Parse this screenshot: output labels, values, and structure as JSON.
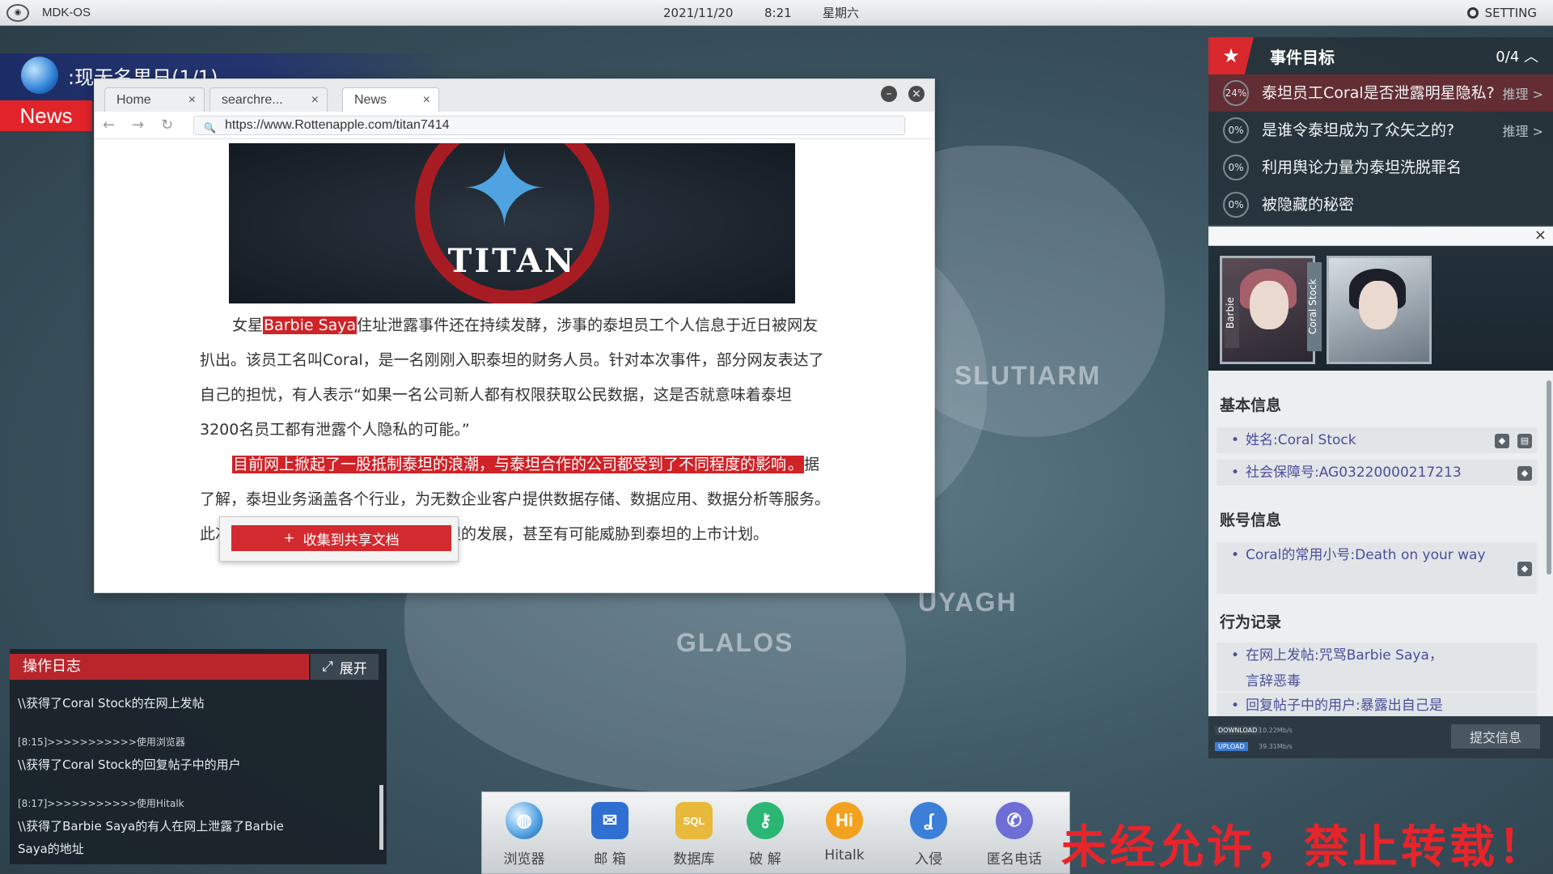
{
  "topbar": {
    "os_name": "MDK-OS",
    "date": "2021/11/20",
    "time": "8:21",
    "weekday": "星期六",
    "setting_label": "SETTING"
  },
  "news_banner": {
    "headline": ":现无名男日(1/1)",
    "label": "News"
  },
  "map_labels": [
    "SLUTIARM",
    "UYAGH",
    "GLALOS"
  ],
  "browser": {
    "tabs": [
      {
        "label": "Home",
        "close": "×"
      },
      {
        "label": "searchre...",
        "close": "×"
      },
      {
        "label": "News",
        "close": "×"
      }
    ],
    "minimize_glyph": "–",
    "close_glyph": "×",
    "nav": {
      "back": "←",
      "forward": "→",
      "reload": "↻"
    },
    "url": "https://www.Rottenapple.com/titan7414",
    "hero_brand": "TITAN",
    "article": {
      "p1_pre": "女星",
      "p1_highlight": "Barbie Saya",
      "p1_post": "住址泄露事件还在持续发酵，涉事的泰坦员工个人信息于近日被网友扒出。该员工名叫Coral，是一名刚刚入职泰坦的财务人员。针对本次事件，部分网友表达了自己的担忧，有人表示“如果一名公司新人都有权限获取公民数据，这是否就意味着泰坦3200名员工都有泄露个人隐私的可能。”",
      "p2_highlight": "目前网上掀起了一股抵制泰坦的浪潮，与泰坦合作的公司都受到了不同程度的影响",
      "p2_highlight_end": "。",
      "p2_post": "据了解，泰坦业务涵盖各个行业，为无数企业客户提供数据存储、数据应用、数据分析等服务。此次抵制风波很可能将极大地影响泰坦的发展，甚至有可能威胁到泰坦的上市计划。"
    },
    "collect_button": "收集到共享文档"
  },
  "events": {
    "title": "事件目标",
    "count": "0/4",
    "items": [
      {
        "percent": "24%",
        "text": "泰坦员工Coral是否泄露明星隐私?",
        "tag": "推理 >"
      },
      {
        "percent": "0%",
        "text": "是谁令泰坦成为了众矢之的?",
        "tag": "推理 >"
      },
      {
        "percent": "0%",
        "text": "利用舆论力量为泰坦洗脱罪名",
        "tag": ""
      },
      {
        "percent": "0%",
        "text": "被隐藏的秘密",
        "tag": ""
      }
    ]
  },
  "card": {
    "close": "×",
    "portrait_name": "Coral Stock",
    "side_portrait_name": "Barbie",
    "basic_title": "基本信息",
    "name": "姓名:Coral Stock",
    "ssn": "社会保障号:AG03220000217213",
    "account_title": "账号信息",
    "alt_account": "Coral的常用小号:Death on your way",
    "behavior_title": "行为记录",
    "behavior_1": "在网上发帖:咒骂Barbie Saya，言辞恶毒",
    "behavior_2": "回复帖子中的用户:暴露出自己是泰坦公司的员工",
    "download_label": "DOWNLOAD",
    "upload_label": "UPLOAD",
    "download_speed": "10.22Mb/s",
    "upload_speed": "39.31Mb/s",
    "submit": "提交信息"
  },
  "oplog": {
    "title": "操作日志",
    "expand": "展开",
    "lines": [
      "\\\\获得了Coral Stock的在网上发帖",
      "[8:15]>>>>>>>>>>>使用浏览器",
      "\\\\获得了Coral Stock的回复帖子中的用户",
      "[8:17]>>>>>>>>>>>使用Hitalk",
      "\\\\获得了Barbie Saya的有人在网上泄露了Barbie",
      "Saya的地址"
    ]
  },
  "dock": {
    "items": [
      {
        "label": "浏览器",
        "icon": "globe-icon"
      },
      {
        "label": "邮 箱",
        "icon": "mail-icon"
      },
      {
        "label": "数据库",
        "icon": "sql-icon"
      },
      {
        "label": "破 解",
        "icon": "key-icon"
      },
      {
        "label": "Hitalk",
        "icon": "hi-icon"
      },
      {
        "label": "入侵",
        "icon": "hook-icon"
      },
      {
        "label": "匿名电话",
        "icon": "phone-icon"
      }
    ]
  },
  "watermark": "未经允许，禁止转载！"
}
